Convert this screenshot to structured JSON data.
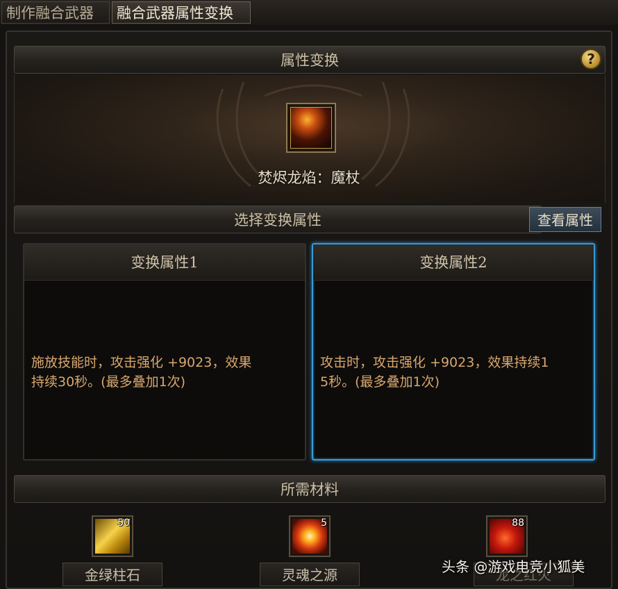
{
  "tabs": [
    {
      "label": "制作融合武器"
    },
    {
      "label": "融合武器属性变换"
    }
  ],
  "header": {
    "title": "属性变换",
    "help_label": "?"
  },
  "weapon": {
    "name": "焚烬龙焰：魔杖",
    "icon": "dragon-flame-staff-icon"
  },
  "select_section": {
    "title": "选择变换属性",
    "view_button": "查看属性"
  },
  "options": [
    {
      "title": "变换属性1",
      "text": "施放技能时，攻击强化 +9023，效果\n持续30秒。(最多叠加1次)",
      "selected": false
    },
    {
      "title": "变换属性2",
      "text": "攻击时，攻击强化 +9023，效果持续1\n5秒。(最多叠加1次)",
      "selected": true
    }
  ],
  "materials_section": {
    "title": "所需材料"
  },
  "materials": [
    {
      "name": "金绿柱石",
      "count": "50",
      "icon": "gold-crystal-icon"
    },
    {
      "name": "灵魂之源",
      "count": "5",
      "icon": "soul-source-icon"
    },
    {
      "name": "龙之红火",
      "count": "88",
      "icon": "red-flame-icon"
    }
  ],
  "watermark": "头条 @游戏电竞小狐美",
  "colors": {
    "selected_border": "#3a9ad6",
    "option_text": "#d9a76e",
    "help_gold": "#c99a34"
  }
}
